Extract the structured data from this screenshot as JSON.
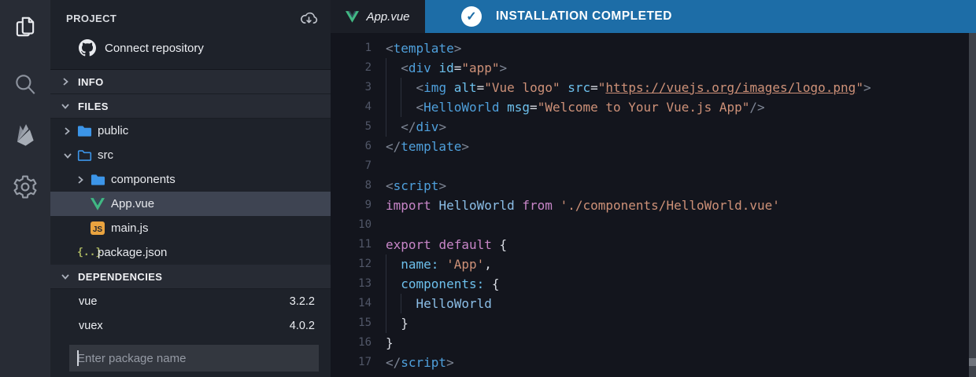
{
  "activity_bar": {
    "icons": [
      {
        "name": "files-icon",
        "active": true
      },
      {
        "name": "search-icon",
        "active": false
      },
      {
        "name": "firebase-icon",
        "active": false
      },
      {
        "name": "settings-gear-icon",
        "active": false
      }
    ]
  },
  "sidebar": {
    "project": {
      "title": "PROJECT",
      "connect_label": "Connect repository"
    },
    "sections": {
      "info": "INFO",
      "files": "FILES",
      "dependencies": "DEPENDENCIES"
    },
    "file_tree": [
      {
        "label": "public",
        "type": "folder",
        "level": 1,
        "chevron": "right",
        "selected": false
      },
      {
        "label": "src",
        "type": "folder-open",
        "level": 1,
        "chevron": "down",
        "selected": false
      },
      {
        "label": "components",
        "type": "folder",
        "level": 2,
        "chevron": "right",
        "selected": false
      },
      {
        "label": "App.vue",
        "type": "vue",
        "level": 2,
        "chevron": "none",
        "selected": true
      },
      {
        "label": "main.js",
        "type": "js",
        "level": 2,
        "chevron": "none",
        "selected": false
      },
      {
        "label": "package.json",
        "type": "json",
        "level": 1,
        "chevron": "none",
        "selected": false
      }
    ],
    "dependencies": [
      {
        "name": "vue",
        "version": "3.2.2"
      },
      {
        "name": "vuex",
        "version": "4.0.2"
      }
    ],
    "add_dependency_placeholder": "Enter package name"
  },
  "editor": {
    "tab": {
      "label": "App.vue",
      "icon": "vue-logo-icon"
    },
    "notification": {
      "label": "INSTALLATION COMPLETED",
      "icon": "check-circle-icon"
    },
    "code_lines": [
      {
        "n": 1,
        "indent": 0,
        "tokens": [
          [
            "<",
            "pun"
          ],
          [
            "template",
            "tag"
          ],
          [
            ">",
            "pun"
          ]
        ]
      },
      {
        "n": 2,
        "indent": 1,
        "tokens": [
          [
            "<",
            "pun"
          ],
          [
            "div",
            "tag"
          ],
          [
            " ",
            "pln"
          ],
          [
            "id",
            "attr"
          ],
          [
            "=",
            "pln"
          ],
          [
            "\"app\"",
            "str"
          ],
          [
            ">",
            "pun"
          ]
        ]
      },
      {
        "n": 3,
        "indent": 2,
        "tokens": [
          [
            "<",
            "pun"
          ],
          [
            "img",
            "tag"
          ],
          [
            " ",
            "pln"
          ],
          [
            "alt",
            "attr"
          ],
          [
            "=",
            "pln"
          ],
          [
            "\"Vue logo\"",
            "str"
          ],
          [
            " ",
            "pln"
          ],
          [
            "src",
            "attr"
          ],
          [
            "=",
            "pln"
          ],
          [
            "\"",
            "str"
          ],
          [
            "https://vuejs.org/images/logo.png",
            "lnk"
          ],
          [
            "\"",
            "str"
          ],
          [
            ">",
            "pun"
          ]
        ]
      },
      {
        "n": 4,
        "indent": 2,
        "tokens": [
          [
            "<",
            "pun"
          ],
          [
            "HelloWorld",
            "tag"
          ],
          [
            " ",
            "pln"
          ],
          [
            "msg",
            "attr"
          ],
          [
            "=",
            "pln"
          ],
          [
            "\"Welcome to Your Vue.js App\"",
            "str"
          ],
          [
            "/>",
            "pun"
          ]
        ]
      },
      {
        "n": 5,
        "indent": 1,
        "tokens": [
          [
            "</",
            "pun"
          ],
          [
            "div",
            "tag"
          ],
          [
            ">",
            "pun"
          ]
        ]
      },
      {
        "n": 6,
        "indent": 0,
        "tokens": [
          [
            "</",
            "pun"
          ],
          [
            "template",
            "tag"
          ],
          [
            ">",
            "pun"
          ]
        ]
      },
      {
        "n": 7,
        "indent": 0,
        "tokens": []
      },
      {
        "n": 8,
        "indent": 0,
        "tokens": [
          [
            "<",
            "pun"
          ],
          [
            "script",
            "tag"
          ],
          [
            ">",
            "pun"
          ]
        ]
      },
      {
        "n": 9,
        "indent": 0,
        "tokens": [
          [
            "import",
            "kw"
          ],
          [
            " ",
            "pln"
          ],
          [
            "HelloWorld",
            "id"
          ],
          [
            " ",
            "pln"
          ],
          [
            "from",
            "kw"
          ],
          [
            " ",
            "pln"
          ],
          [
            "'./components/HelloWorld.vue'",
            "str"
          ]
        ]
      },
      {
        "n": 10,
        "indent": 0,
        "tokens": []
      },
      {
        "n": 11,
        "indent": 0,
        "tokens": [
          [
            "export",
            "kw"
          ],
          [
            " ",
            "pln"
          ],
          [
            "default",
            "kw"
          ],
          [
            " ",
            "pln"
          ],
          [
            "{",
            "pln"
          ]
        ]
      },
      {
        "n": 12,
        "indent": 1,
        "tokens": [
          [
            "name",
            "attr"
          ],
          [
            ":",
            "attr"
          ],
          [
            " ",
            "pln"
          ],
          [
            "'App'",
            "str"
          ],
          [
            ",",
            "pln"
          ]
        ]
      },
      {
        "n": 13,
        "indent": 1,
        "tokens": [
          [
            "components",
            "attr"
          ],
          [
            ":",
            "attr"
          ],
          [
            " ",
            "pln"
          ],
          [
            "{",
            "pln"
          ]
        ]
      },
      {
        "n": 14,
        "indent": 2,
        "tokens": [
          [
            "HelloWorld",
            "id"
          ]
        ]
      },
      {
        "n": 15,
        "indent": 1,
        "tokens": [
          [
            "}",
            "pln"
          ]
        ]
      },
      {
        "n": 16,
        "indent": 0,
        "tokens": [
          [
            "}",
            "pln"
          ]
        ]
      },
      {
        "n": 17,
        "indent": 0,
        "tokens": [
          [
            "</",
            "pun"
          ],
          [
            "script",
            "tag"
          ],
          [
            ">",
            "pun"
          ]
        ]
      }
    ]
  },
  "colors": {
    "banner_blue": "#1d6da7",
    "vue_green": "#41b883",
    "vue_dark": "#2f4858",
    "folder_blue": "#3c95e8",
    "js_yellow": "#e9a33f",
    "json_olive": "#a9b460",
    "editor_bg": "#13151d",
    "sidebar_bg": "#1e222a",
    "section_header_bg": "#272b34",
    "activity_bar_bg": "#282c35",
    "selected_row_bg": "#3e4452"
  }
}
